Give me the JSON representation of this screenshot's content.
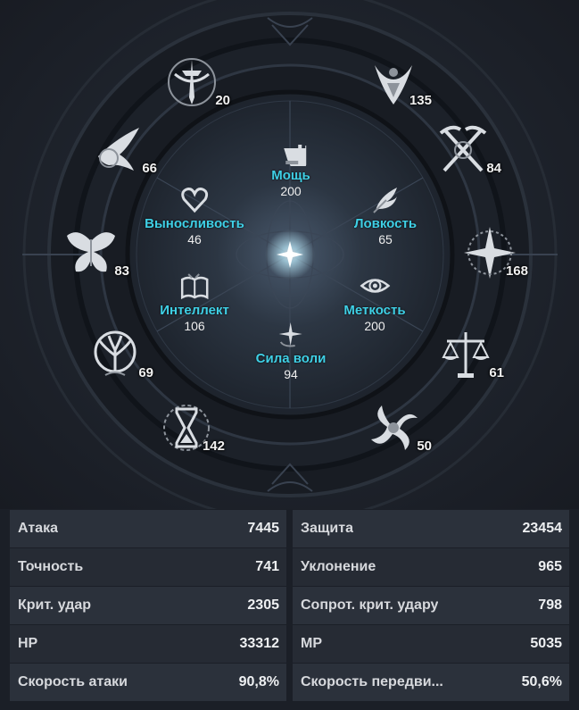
{
  "outer_nodes": [
    {
      "name": "outer-node-sword-crest",
      "icon": "sword-crest-icon",
      "value": "20"
    },
    {
      "name": "outer-node-horned-helm",
      "icon": "horned-helm-icon",
      "value": "135"
    },
    {
      "name": "outer-node-winged-bird",
      "icon": "winged-bird-icon",
      "value": "66"
    },
    {
      "name": "outer-node-crossed-scythes",
      "icon": "crossed-scythes-icon",
      "value": "84"
    },
    {
      "name": "outer-node-butterfly",
      "icon": "butterfly-icon",
      "value": "83"
    },
    {
      "name": "outer-node-star-compass",
      "icon": "star-compass-icon",
      "value": "168"
    },
    {
      "name": "outer-node-tree-of-life",
      "icon": "tree-of-life-icon",
      "value": "69"
    },
    {
      "name": "outer-node-scales",
      "icon": "scales-icon",
      "value": "61"
    },
    {
      "name": "outer-node-hourglass",
      "icon": "hourglass-icon",
      "value": "142"
    },
    {
      "name": "outer-node-swirl",
      "icon": "swirl-icon",
      "value": "50"
    }
  ],
  "inner_stats": [
    {
      "name": "Мощь",
      "value": "200",
      "icon": "fist-icon"
    },
    {
      "name": "Выносливость",
      "value": "46",
      "icon": "heart-icon"
    },
    {
      "name": "Ловкость",
      "value": "65",
      "icon": "feather-icon"
    },
    {
      "name": "Интеллект",
      "value": "106",
      "icon": "book-icon"
    },
    {
      "name": "Меткость",
      "value": "200",
      "icon": "eye-icon"
    },
    {
      "name": "Сила воли",
      "value": "94",
      "icon": "sparkle-icon"
    }
  ],
  "stats_table": [
    {
      "label": "Атака",
      "value": "7445"
    },
    {
      "label": "Защита",
      "value": "23454"
    },
    {
      "label": "Точность",
      "value": "741"
    },
    {
      "label": "Уклонение",
      "value": "965"
    },
    {
      "label": "Крит. удар",
      "value": "2305"
    },
    {
      "label": "Сопрот. крит. удару",
      "value": "798"
    },
    {
      "label": "HP",
      "value": "33312"
    },
    {
      "label": "MP",
      "value": "5035"
    },
    {
      "label": "Скорость атаки",
      "value": "90,8%"
    },
    {
      "label": "Скорость передви...",
      "value": "50,6%"
    }
  ],
  "colors": {
    "accent_cyan": "#3fd0e6",
    "icon_silver": "#d9dde2",
    "ring_dark": "#14181e",
    "row_odd": "#2b313b",
    "row_even": "#262b34"
  }
}
